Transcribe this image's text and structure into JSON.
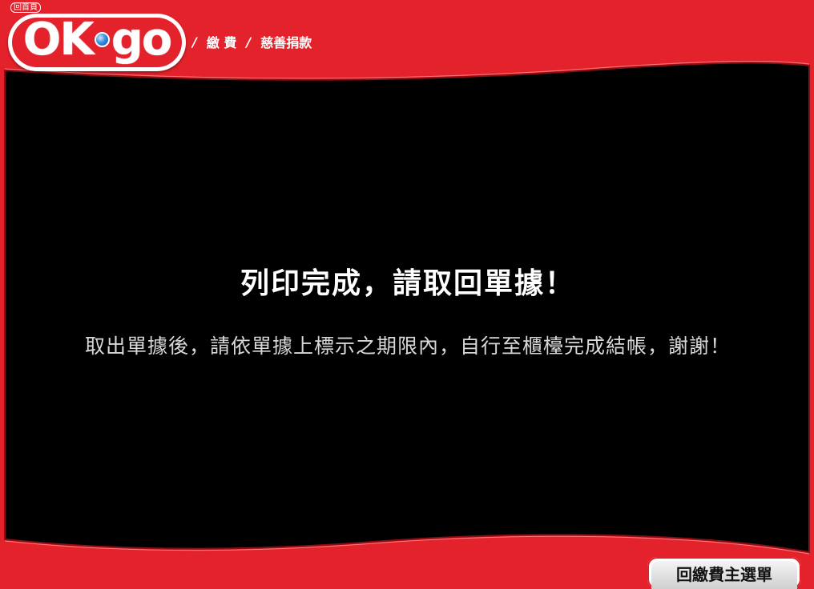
{
  "header": {
    "home_label": "回首頁",
    "logo_text_left": "OK",
    "logo_text_right": "go",
    "breadcrumb": {
      "sep1": "/",
      "item1": "繳 費",
      "sep2": "/",
      "item2": "慈善捐款"
    }
  },
  "main": {
    "title": "列印完成，請取回單據！",
    "message": "取出單據後，請依單據上標示之期限內，自行至櫃檯完成結帳，謝謝！"
  },
  "footer": {
    "back_button_label": "回繳費主選單"
  },
  "colors": {
    "brand_red": "#e3222b",
    "panel_black": "#000000",
    "logo_dot_blue": "#3a8fe0"
  }
}
